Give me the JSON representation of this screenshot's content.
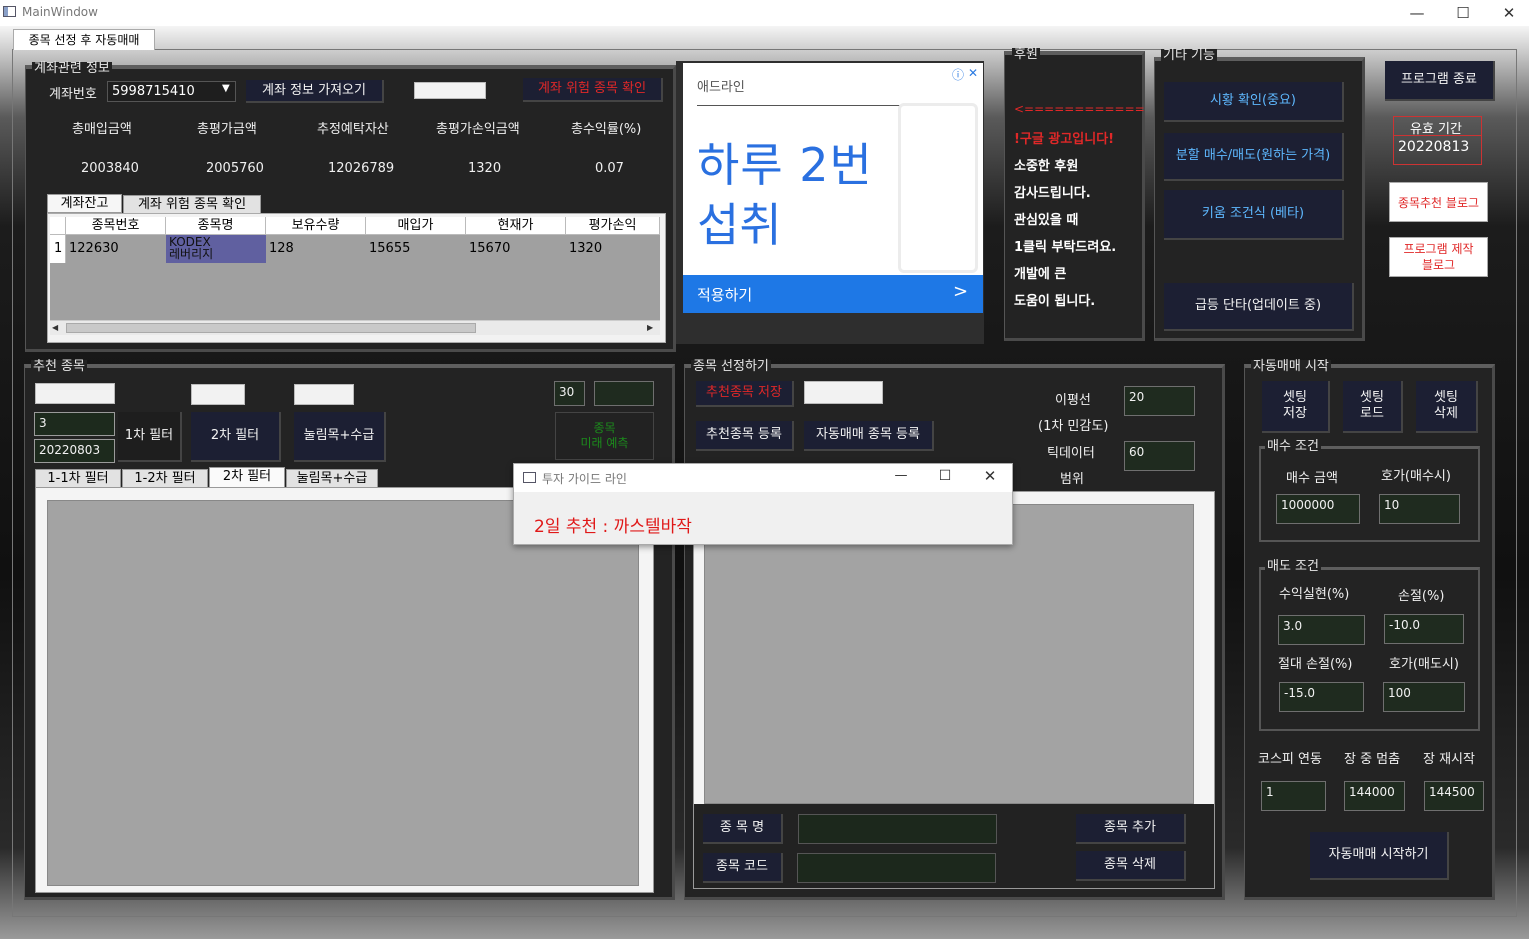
{
  "window": {
    "title": "MainWindow"
  },
  "tab": {
    "label": "종목 선정 후 자동매매"
  },
  "account": {
    "group_label": "계좌관련 정보",
    "account_no_label": "계좌번호",
    "account_no_value": "5998715410",
    "fetch_button": "계좌 정보 가져오기",
    "risk_button": "계좌 위험 종목 확인",
    "summary_headers": [
      "총매입금액",
      "총평가금액",
      "추정예탁자산",
      "총평가손익금액",
      "총수익률(%)"
    ],
    "summary_values": [
      "2003840",
      "2005760",
      "12026789",
      "1320",
      "0.07"
    ],
    "subtabs": [
      "계좌잔고",
      "계좌 위험 종목 확인"
    ],
    "table_headers": [
      "종목번호",
      "종목명",
      "보유수량",
      "매입가",
      "현재가",
      "평가손익"
    ],
    "rows": [
      {
        "index": "1",
        "cells": [
          "122630",
          "KODEX\n레버리지",
          "128",
          "15655",
          "15670",
          "1320"
        ]
      }
    ]
  },
  "ad": {
    "brand": "애드라인",
    "headline_line1": "하루 2번",
    "headline_line2": "섭취",
    "cta": "적용하기",
    "cta_arrow": ">",
    "info_icon": "ⓘ",
    "close_icon": "✕"
  },
  "sponsor": {
    "group_label": "후원",
    "arrow_text": "<============",
    "ad_notice": "!구글 광고입니다!",
    "lines": [
      "소중한 후원",
      "감사드립니다.",
      "관심있을 때",
      "1클릭 부탁드려요.",
      "개발에 큰",
      "도움이 됩니다."
    ]
  },
  "other": {
    "group_label": "기타 기능",
    "buttons": [
      "시황 확인(중요)",
      "분할 매수/매도(원하는 가격)",
      "키움 조건식 (베타)",
      "급등 단타(업데이트 중)"
    ]
  },
  "right_top": {
    "exit_button": "프로그램 종료",
    "expiry_label": "유효 기간",
    "expiry_value": "20220813",
    "blog_button": "종목추천 블로그",
    "maker_blog_line1": "프로그램 제작",
    "maker_blog_line2": "블로그"
  },
  "recommend": {
    "group_label": "추천 종목",
    "input_days": "3",
    "input_date": "20220803",
    "filter1_button": "1차 필터",
    "filter2_button": "2차 필터",
    "pressure_button": "눌림목+수급",
    "count_value": "30",
    "predict_line1": "종목",
    "predict_line2": "미래 예측",
    "subtabs": [
      "1-1차 필터",
      "1-2차 필터",
      "2차 필터",
      "눌림목+수급"
    ],
    "active_subtab": 2
  },
  "selection": {
    "group_label": "종목 선정하기",
    "save_button": "추천종목 저장",
    "register_button": "추천종목 등록",
    "auto_register_button": "자동매매 종목 등록",
    "ma_label": "이평선",
    "ma_value": "20",
    "sensitivity_label": "(1차 민감도)",
    "tick_label": "틱데이터",
    "tick_value": "60",
    "range_label": "범위",
    "name_label": "종 목 명",
    "code_label": "종목 코드",
    "add_button": "종목 추가",
    "delete_button": "종목 삭제"
  },
  "auto": {
    "group_label": "자동매매 시작",
    "save_line1": "셋팅",
    "save_line2": "저장",
    "load_line1": "셋팅",
    "load_line2": "로드",
    "del_line1": "셋팅",
    "del_line2": "삭제",
    "buy_group": "매수 조건",
    "buy_amount_label": "매수 금액",
    "buy_amount": "1000000",
    "buy_tick_label": "호가(매수시)",
    "buy_tick": "10",
    "sell_group": "매도 조건",
    "profit_label": "수익실현(%)",
    "profit": "3.0",
    "loss_label": "손절(%)",
    "loss": "-10.0",
    "abs_loss_label": "절대 손절(%)",
    "abs_loss": "-15.0",
    "sell_tick_label": "호가(매도시)",
    "sell_tick": "100",
    "kospi_label": "코스피 연동",
    "kospi": "1",
    "pause_label": "장 중 멈춤",
    "pause": "144000",
    "resume_label": "장 재시작",
    "resume": "144500",
    "start_button": "자동매매 시작하기"
  },
  "popup": {
    "title": "투자 가이드 라인",
    "message": "2일 추천 : 까스텔바작"
  }
}
